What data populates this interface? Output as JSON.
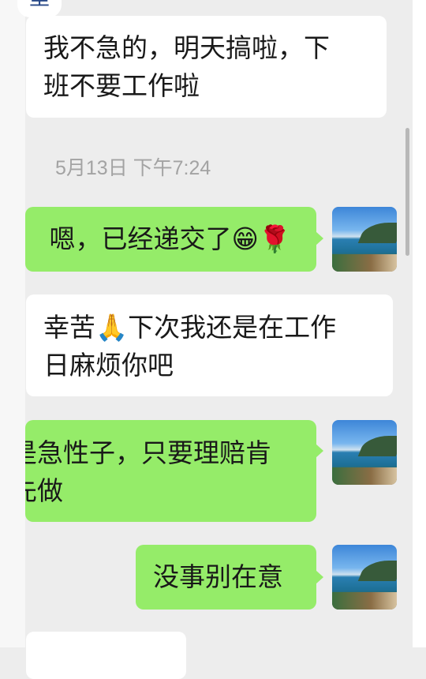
{
  "top_fragment": "里",
  "timestamp": "5月13日 下午7:24",
  "messages": [
    {
      "side": "in",
      "lines": [
        "我不急的，明天搞啦，下",
        "班不要工作啦"
      ]
    },
    {
      "side": "out",
      "lines": [
        "嗯，已经递交了😁🌹"
      ]
    },
    {
      "side": "in",
      "lines": [
        "幸苦🙏下次我还是在工作",
        "日麻烦你吧"
      ]
    },
    {
      "side": "out",
      "lines": [
        "是急性子，只要理赔肯",
        "先做"
      ]
    },
    {
      "side": "out",
      "lines": [
        "没事别在意"
      ]
    },
    {
      "side": "in",
      "lines": [
        ""
      ]
    }
  ]
}
